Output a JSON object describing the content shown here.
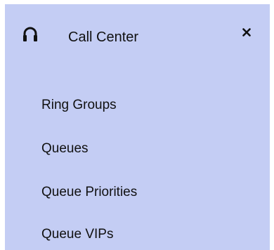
{
  "header": {
    "icon": "headset-icon",
    "title": "Call Center",
    "close_icon": "close-icon"
  },
  "menu": {
    "items": [
      {
        "label": "Ring Groups"
      },
      {
        "label": "Queues"
      },
      {
        "label": "Queue Priorities"
      },
      {
        "label": "Queue VIPs"
      }
    ]
  },
  "colors": {
    "panel_background": "#c4cdf4",
    "text": "#111111"
  }
}
